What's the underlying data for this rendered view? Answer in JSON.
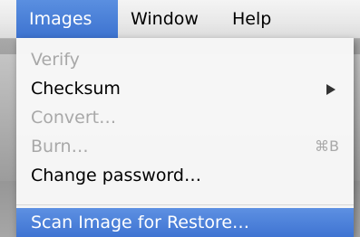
{
  "menubar": {
    "items": [
      {
        "label": "Images",
        "selected": true
      },
      {
        "label": "Window",
        "selected": false
      },
      {
        "label": "Help",
        "selected": false
      }
    ]
  },
  "images_menu": {
    "items": [
      {
        "label": "Verify",
        "enabled": false
      },
      {
        "label": "Checksum",
        "enabled": true,
        "submenu": true
      },
      {
        "label": "Convert…",
        "enabled": false
      },
      {
        "label": "Burn…",
        "enabled": false,
        "shortcut": "⌘B"
      },
      {
        "label": "Change password…",
        "enabled": true
      },
      {
        "label": "Scan Image for Restore…",
        "enabled": true,
        "highlighted": true
      }
    ]
  },
  "colors": {
    "selection": "#3f74d2",
    "disabled_text": "#a8a8a8",
    "menu_background": "#f8f8f8"
  }
}
